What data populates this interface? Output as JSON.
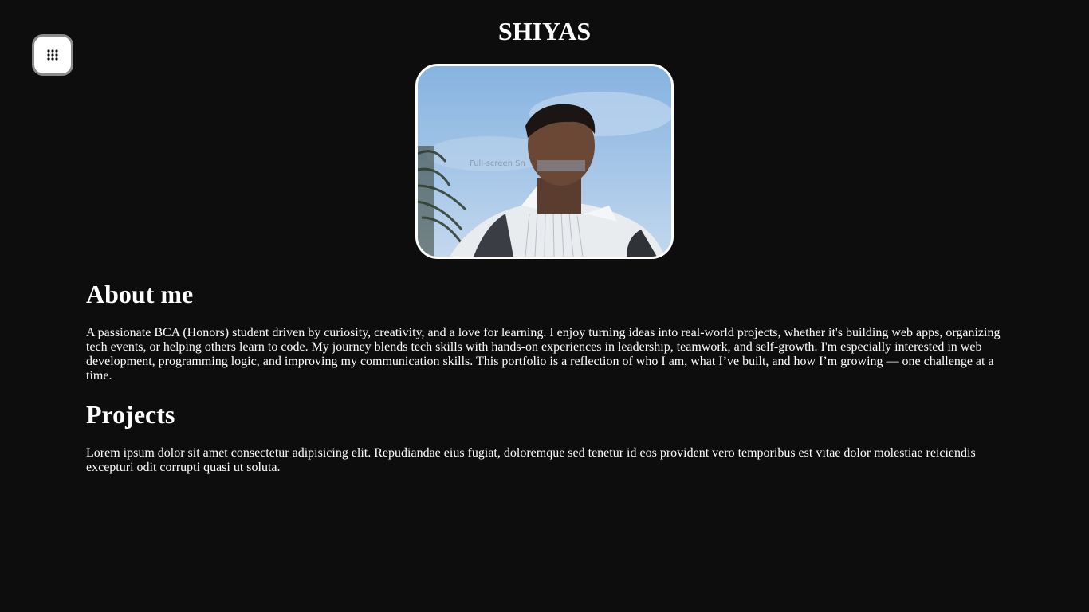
{
  "header": {
    "title": "SHIYAS"
  },
  "menu": {
    "icon": "apps-grid-icon"
  },
  "profile": {
    "photo_alt": "profile photo",
    "photo_overlay_text": "Full-screen Sn"
  },
  "about": {
    "heading": "About me",
    "text": "A passionate BCA (Honors) student driven by curiosity, creativity, and a love for learning. I enjoy turning ideas into real-world projects, whether it's building web apps, organizing tech events, or helping others learn to code. My journey blends tech skills with hands-on experiences in leadership, teamwork, and self-growth. I'm especially interested in web development, programming logic, and improving my communication skills. This portfolio is a reflection of who I am, what I’ve built, and how I’m growing — one challenge at a time."
  },
  "projects": {
    "heading": "Projects",
    "text": "Lorem ipsum dolor sit amet consectetur adipisicing elit. Repudiandae eius fugiat, doloremque sed tenetur id eos provident vero temporibus est vitae dolor molestiae reiciendis excepturi odit corrupti quasi ut soluta."
  },
  "colors": {
    "background": "#0d0d0d",
    "text": "#ffffff",
    "button_bg": "#ffffff",
    "button_border": "#8a8a8a"
  }
}
